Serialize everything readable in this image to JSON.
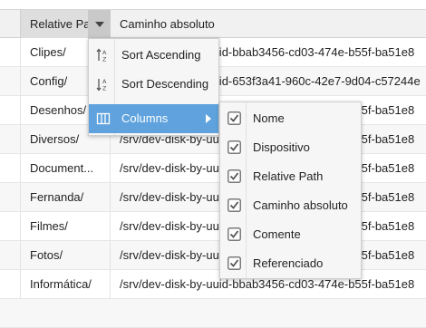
{
  "header": {
    "col1": "Relative Pa",
    "col2": "Caminho absoluto"
  },
  "rows": [
    {
      "c1": "Clipes/",
      "c2": "/srv/dev-disk-by-uuid-bbab3456-cd03-474e-b55f-ba51e8"
    },
    {
      "c1": "Config/",
      "c2": "/srv/dev-disk-by-uuid-653f3a41-960c-42e7-9d04-c57244e"
    },
    {
      "c1": "Desenhos/",
      "c2": "/srv/dev-disk-by-uuid-bbab3456-cd03-474e-b55f-ba51e8"
    },
    {
      "c1": "Diversos/",
      "c2": "/srv/dev-disk-by-uuid-bbab3456-cd03-474e-b55f-ba51e8"
    },
    {
      "c1": "Document...",
      "c2": "/srv/dev-disk-by-uuid-bbab3456-cd03-474e-b55f-ba51e8"
    },
    {
      "c1": "Fernanda/",
      "c2": "/srv/dev-disk-by-uuid-bbab3456-cd03-474e-b55f-ba51e8"
    },
    {
      "c1": "Filmes/",
      "c2": "/srv/dev-disk-by-uuid-bbab3456-cd03-474e-b55f-ba51e8"
    },
    {
      "c1": "Fotos/",
      "c2": "/srv/dev-disk-by-uuid-bbab3456-cd03-474e-b55f-ba51e8"
    },
    {
      "c1": "Informática/",
      "c2": "/srv/dev-disk-by-uuid-bbab3456-cd03-474e-b55f-ba51e8"
    }
  ],
  "menu": {
    "sort_asc": "Sort Ascending",
    "sort_desc": "Sort Descending",
    "columns": "Columns"
  },
  "columns_menu": [
    {
      "label": "Nome",
      "checked": true
    },
    {
      "label": "Dispositivo",
      "checked": true
    },
    {
      "label": "Relative Path",
      "checked": true
    },
    {
      "label": "Caminho absoluto",
      "checked": true
    },
    {
      "label": "Comente",
      "checked": true
    },
    {
      "label": "Referenciado",
      "checked": true
    }
  ],
  "colors": {
    "accent": "#5fa2dd"
  }
}
